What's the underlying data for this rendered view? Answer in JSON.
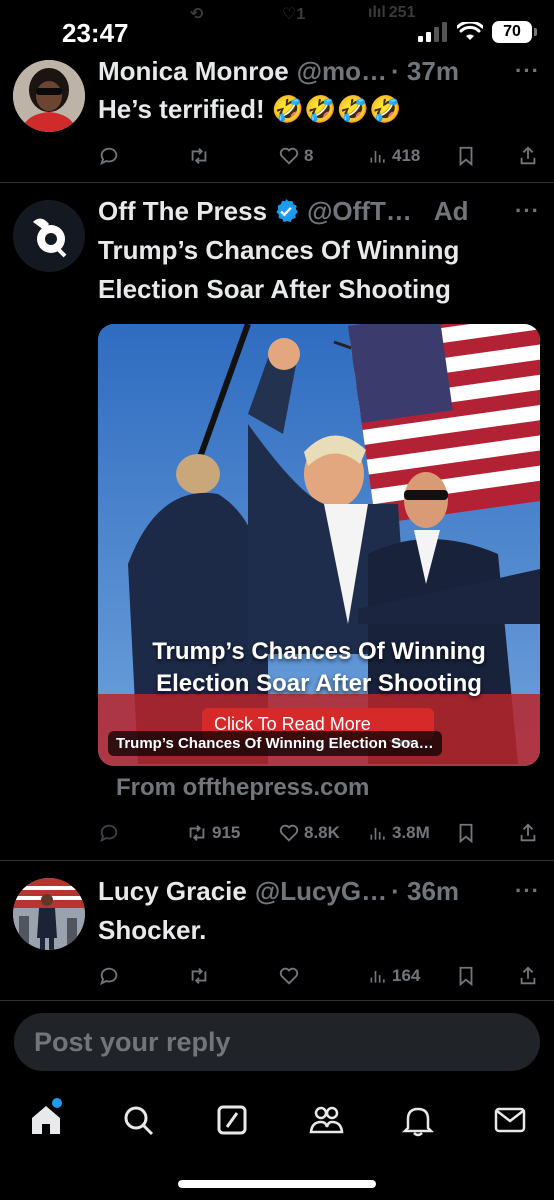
{
  "status_bar": {
    "time": "23:47",
    "battery": "70",
    "ghost_counts": {
      "likes": "1",
      "views": "251"
    }
  },
  "tweets": [
    {
      "name": "Monica Monroe",
      "handle": "@mo…",
      "time": "· 37m",
      "text": "He’s terrified! 🤣🤣🤣🤣",
      "counts": {
        "likes": "8",
        "views": "418"
      },
      "more": "···"
    },
    {
      "name": "Off The Press",
      "verified": true,
      "handle": "@OffT…",
      "ad_label": "Ad",
      "text": "Trump’s Chances Of Winning Election Soar After Shooting",
      "card": {
        "headline_line1": "Trump’s Chances Of Winning",
        "headline_line2": "Election Soar After Shooting",
        "cta": "Click To Read More",
        "caption": "Trump’s Chances Of Winning Election Soa…"
      },
      "from": "From offthepress.com",
      "counts": {
        "retweets": "915",
        "likes": "8.8K",
        "views": "3.8M"
      },
      "more": "···"
    },
    {
      "name": "Lucy Gracie",
      "handle": "@LucyG…",
      "time": "· 36m",
      "text": "Shocker.",
      "counts": {
        "views": "164"
      },
      "more": "···"
    }
  ],
  "reply": {
    "placeholder": "Post your reply"
  },
  "nav": [
    "home",
    "search",
    "grok",
    "communities",
    "notifications",
    "messages"
  ],
  "colors": {
    "background": "#000000",
    "text": "#e7e9ea",
    "muted": "#71767b",
    "accent": "#1d9bf0",
    "divider": "#2f3336"
  }
}
